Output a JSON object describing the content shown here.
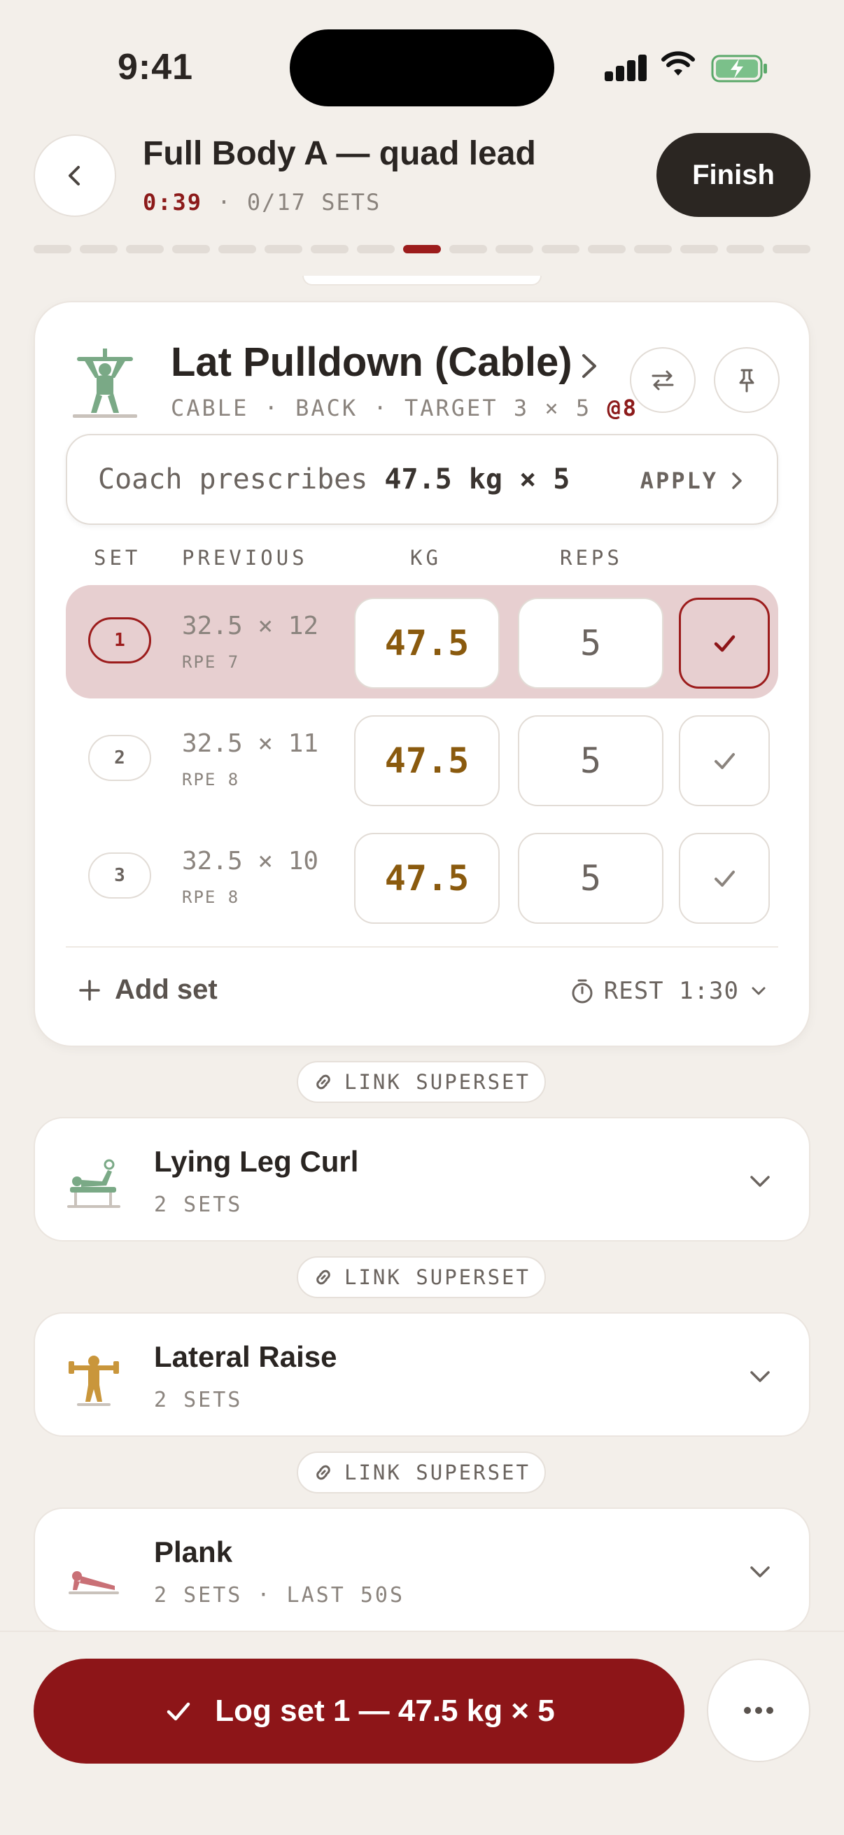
{
  "status_bar": {
    "time": "9:41"
  },
  "header": {
    "title": "Full Body A — quad lead",
    "timer": "0:39",
    "separator": " · ",
    "sets_progress": "0/17 SETS",
    "finish_label": "Finish",
    "progress_segments": 17,
    "progress_active_index": 8
  },
  "exercise": {
    "name": "Lat Pulldown (Cable)",
    "meta_prefix": "CABLE · BACK · TARGET 3 × 5",
    "meta_rpe": "@8",
    "coach_prefix": "Coach prescribes",
    "coach_value": "47.5 kg × 5",
    "apply_label": "APPLY",
    "columns": {
      "set": "SET",
      "previous": "PREVIOUS",
      "kg": "KG",
      "reps": "REPS"
    },
    "sets": [
      {
        "num": "1",
        "previous": "32.5 × 12",
        "rpe": "RPE 7",
        "kg": "47.5",
        "reps": "5"
      },
      {
        "num": "2",
        "previous": "32.5 × 11",
        "rpe": "RPE 8",
        "kg": "47.5",
        "reps": "5"
      },
      {
        "num": "3",
        "previous": "32.5 × 10",
        "rpe": "RPE 8",
        "kg": "47.5",
        "reps": "5"
      }
    ],
    "add_set_label": "Add set",
    "rest_label": "REST 1:30"
  },
  "superset_label": "LINK SUPERSET",
  "collapsed": [
    {
      "name": "Lying Leg Curl",
      "sub": "2 SETS",
      "icon": "leg-curl-icon",
      "color": "#7aa986"
    },
    {
      "name": "Lateral Raise",
      "sub": "2 SETS",
      "icon": "lateral-raise-icon",
      "color": "#c9963b"
    },
    {
      "name": "Plank",
      "sub": "2 SETS · LAST 50S",
      "icon": "plank-icon",
      "color": "#c97076"
    }
  ],
  "log_button_label": "Log set 1 — 47.5 kg × 5",
  "colors": {
    "accent": "#8d1518",
    "background": "#f3efea",
    "active_row": "#e7cfd0",
    "kg_text": "#8a5a0e"
  }
}
